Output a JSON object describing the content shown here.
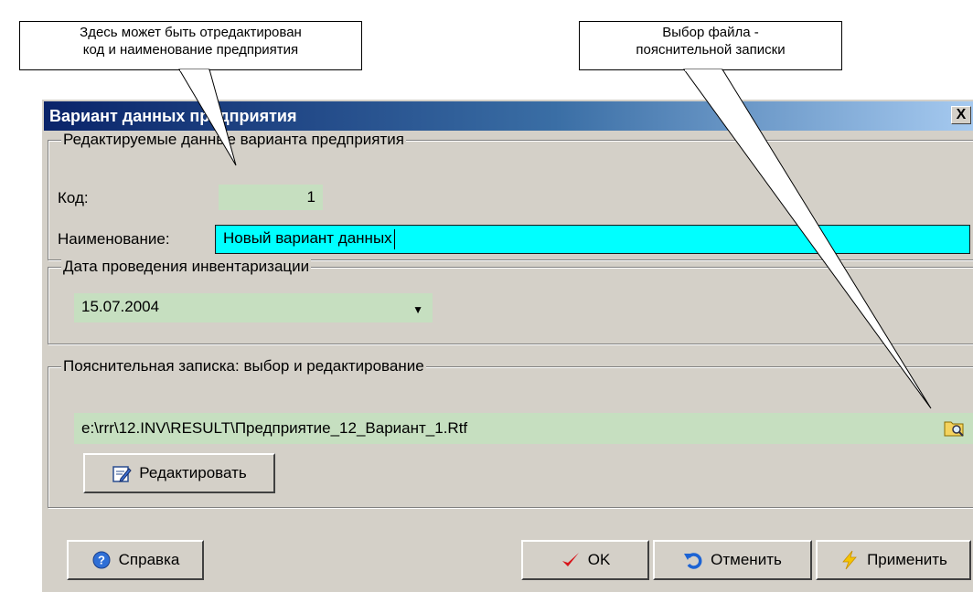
{
  "callouts": {
    "left": "Здесь может быть отредактирован\nкод и наименование предприятия",
    "right": "Выбор файла -\nпояснительной записки"
  },
  "dialog": {
    "title": "Вариант данных предприятия",
    "close_label": "X"
  },
  "group_edit": {
    "legend": "Редактируемые данные варианта предприятия",
    "code_label": "Код:",
    "code_value": "1",
    "name_label": "Наименование:",
    "name_value": "Новый вариант данных"
  },
  "group_date": {
    "legend": "Дата проведения инвентаризации",
    "date_value": "15.07.2004"
  },
  "group_note": {
    "legend": "Пояснительная записка: выбор и редактирование",
    "file_path": "e:\\rrr\\12.INV\\RESULT\\Предприятие_12_Вариант_1.Rtf",
    "edit_label": "Редактировать"
  },
  "buttons": {
    "help": "Справка",
    "ok": "OK",
    "cancel": "Отменить",
    "apply": "Применить"
  },
  "colors": {
    "dialog_bg": "#d4d0c8",
    "title_start": "#0a246a",
    "title_end": "#a6caf0",
    "field_green": "#c6dfc0",
    "field_cyan": "#00ffff"
  }
}
